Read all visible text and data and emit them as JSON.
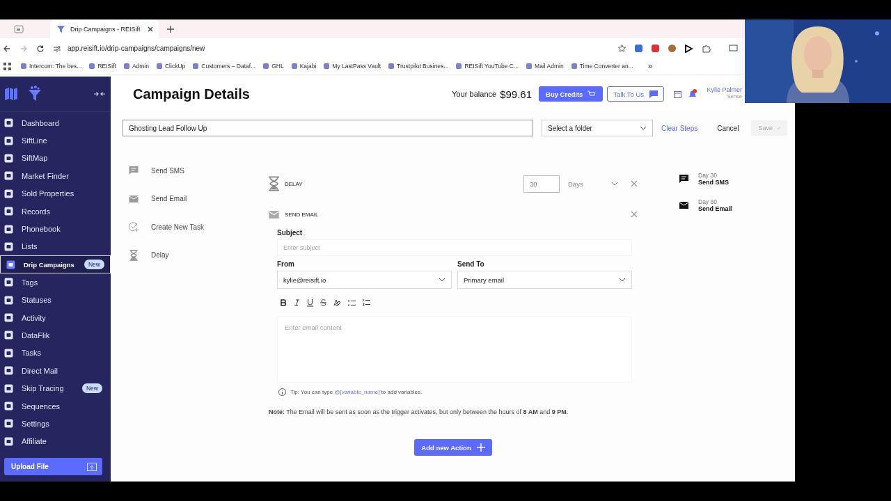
{
  "browser": {
    "tab_title": "Drip Campaigns - REISift",
    "url": "app.reisift.io/drip-campaigns/campaigns/new",
    "bookmarks": [
      "Intercom: The bes...",
      "REISift",
      "Admin",
      "ClickUp",
      "Customers – Dataf...",
      "GHL",
      "Kajabi",
      "My LastPass Vault",
      "Trustpilot Busines...",
      "REISift YouTube C...",
      "Mail Admin",
      "Time Converter an..."
    ],
    "overflow": "»"
  },
  "sidebar": {
    "items": [
      {
        "label": "Dashboard",
        "selected": false
      },
      {
        "label": "SiftLine",
        "selected": false
      },
      {
        "label": "SiftMap",
        "selected": false
      },
      {
        "label": "Market Finder",
        "selected": false
      },
      {
        "label": "Sold Properties",
        "selected": false
      },
      {
        "label": "Records",
        "selected": false
      },
      {
        "label": "Phonebook",
        "selected": false
      },
      {
        "label": "Lists",
        "selected": false
      },
      {
        "label": "Drip Campaigns",
        "selected": true,
        "badge": "New"
      },
      {
        "label": "Tags",
        "selected": false
      },
      {
        "label": "Statuses",
        "selected": false
      },
      {
        "label": "Activity",
        "selected": false
      },
      {
        "label": "DataFlik",
        "selected": false
      },
      {
        "label": "Tasks",
        "selected": false
      },
      {
        "label": "Direct Mail",
        "selected": false
      },
      {
        "label": "Skip Tracing",
        "selected": false,
        "badge": "New"
      },
      {
        "label": "Sequences",
        "selected": false
      },
      {
        "label": "Settings",
        "selected": false
      },
      {
        "label": "Affiliate",
        "selected": false
      }
    ],
    "upload_button": "Upload File"
  },
  "header": {
    "title": "Campaign Details",
    "balance_label": "Your balance",
    "balance": "$99.61",
    "buy_button": "Buy Credits",
    "talk_button": "Talk To Us",
    "user_name": "Kylie Palmer",
    "user_role": "Sense"
  },
  "toolbar": {
    "campaign_name": "Ghosting Lead Follow Up",
    "folder_placeholder": "Select a folder",
    "clear_button": "Clear Steps",
    "cancel_button": "Cancel",
    "save_button": "Save",
    "save_disabled": true
  },
  "actions": [
    {
      "label": "Send SMS",
      "kind": "sms"
    },
    {
      "label": "Send Email",
      "kind": "email"
    },
    {
      "label": "Create New Task",
      "kind": "task"
    },
    {
      "label": "Delay",
      "kind": "delay"
    }
  ],
  "steps": [
    {
      "kind": "delay",
      "title": "DELAY",
      "amount": "30",
      "unit": "Days"
    },
    {
      "kind": "email",
      "title": "SEND EMAIL",
      "subject_label": "Subject",
      "subject_placeholder": "Enter subject",
      "from_label": "From",
      "from_value": "kylie@reisift.io",
      "to_label": "Send To",
      "to_value": "Primary email",
      "content_placeholder": "Enter email content",
      "tip_before": "Tip: You can type",
      "tip_variable": "@[variable_name]",
      "tip_after": "to add variables."
    }
  ],
  "note": "**Note:** The Email will be sent as soon as the trigger activates, but only between the hours of **8 AM** and **9 PM**.",
  "add_action_button": "Add new Action",
  "timeline": [
    {
      "day": "Day 30",
      "label": "Send SMS",
      "kind": "sms"
    },
    {
      "day": "Day 60",
      "label": "Send Email",
      "kind": "email"
    }
  ]
}
